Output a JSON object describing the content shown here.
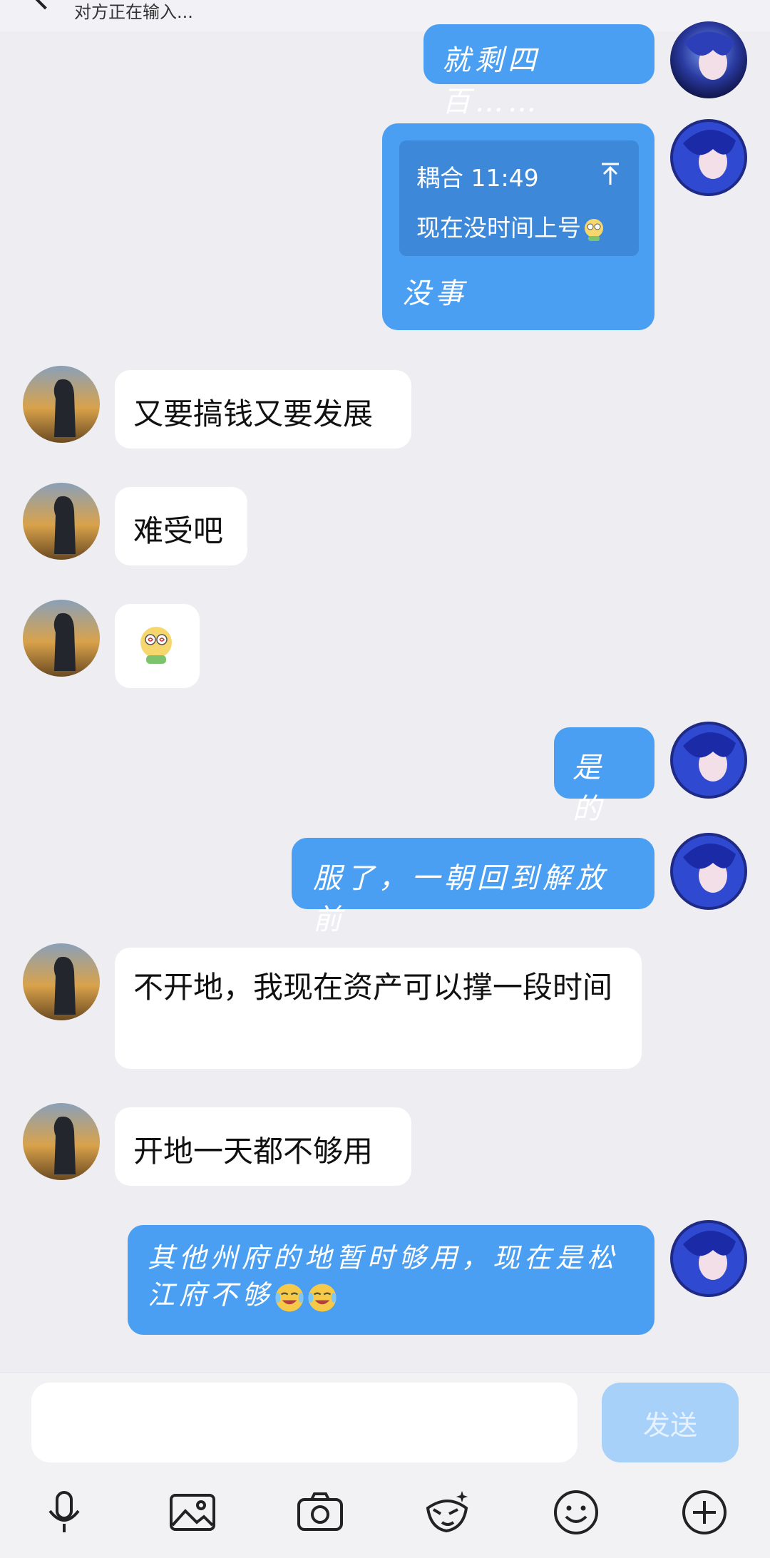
{
  "header": {
    "typing_status": "对方正在输入..."
  },
  "messages": [
    {
      "side": "right",
      "text": "就剩四百……"
    },
    {
      "side": "right",
      "quote_meta": "耦合 11:49",
      "quote_text": "现在没时间上号",
      "text": "没事"
    },
    {
      "side": "left",
      "text": "又要搞钱又要发展"
    },
    {
      "side": "left",
      "text": "难受吧"
    },
    {
      "side": "left",
      "emoji": "dizzy-face-emoji"
    },
    {
      "side": "right",
      "text": "是的"
    },
    {
      "side": "right",
      "text": "服了，一朝回到解放前"
    },
    {
      "side": "left",
      "text": "不开地，我现在资产可以撑一段时间"
    },
    {
      "side": "left",
      "text": "开地一天都不够用"
    },
    {
      "side": "right",
      "text": "其他州府的地暂时够用，现在是松江府不够"
    }
  ],
  "composer": {
    "input_value": "",
    "send_label": "发送"
  },
  "toolbar": [
    "microphone-icon",
    "image-icon",
    "camera-icon",
    "sticker-icon",
    "emoji-icon",
    "plus-icon"
  ],
  "colors": {
    "accent": "#4a9ff2",
    "background": "#eeeef2",
    "send_disabled": "#a8d1fa"
  }
}
